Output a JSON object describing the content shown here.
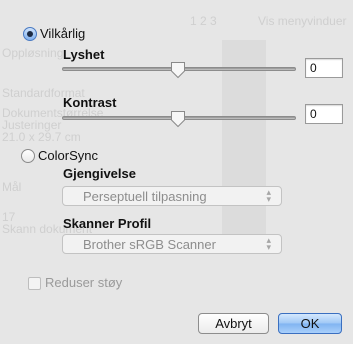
{
  "background_ghost_text": {
    "line1": "1 2 3",
    "line2": "Vis menyvinduer",
    "line3": "Oppløsning",
    "line4": "Standardformat",
    "line5": "Dokumentstørrelse",
    "line6": "Justeringer",
    "line7": "21.0 x 29.7 cm",
    "line8": "Mål",
    "line9": "17",
    "line10": "Skann dokument"
  },
  "mode": {
    "vilkarlig_label": "Vilkårlig",
    "vilkarlig_selected": true,
    "colorsync_label": "ColorSync",
    "colorsync_selected": false
  },
  "brightness": {
    "label": "Lyshet",
    "value": "0",
    "slider_fraction": 0.5
  },
  "contrast": {
    "label": "Kontrast",
    "value": "0",
    "slider_fraction": 0.5
  },
  "rendering": {
    "label": "Gjengivelse",
    "selected": "Perseptuell tilpasning",
    "enabled": false
  },
  "scanner_profile": {
    "label": "Skanner Profil",
    "selected": "Brother sRGB Scanner",
    "enabled": false
  },
  "noise": {
    "label": "Reduser støy",
    "checked": false,
    "enabled": false
  },
  "buttons": {
    "cancel_label": "Avbryt",
    "ok_label": "OK"
  },
  "colors": {
    "accent": "#7fb0ee",
    "window_bg": "#e6e6e6",
    "disabled_text": "#8d8d8d"
  },
  "icons": {
    "select_arrows": "updown-arrows-icon",
    "slider_knob": "slider-thumb-icon"
  }
}
